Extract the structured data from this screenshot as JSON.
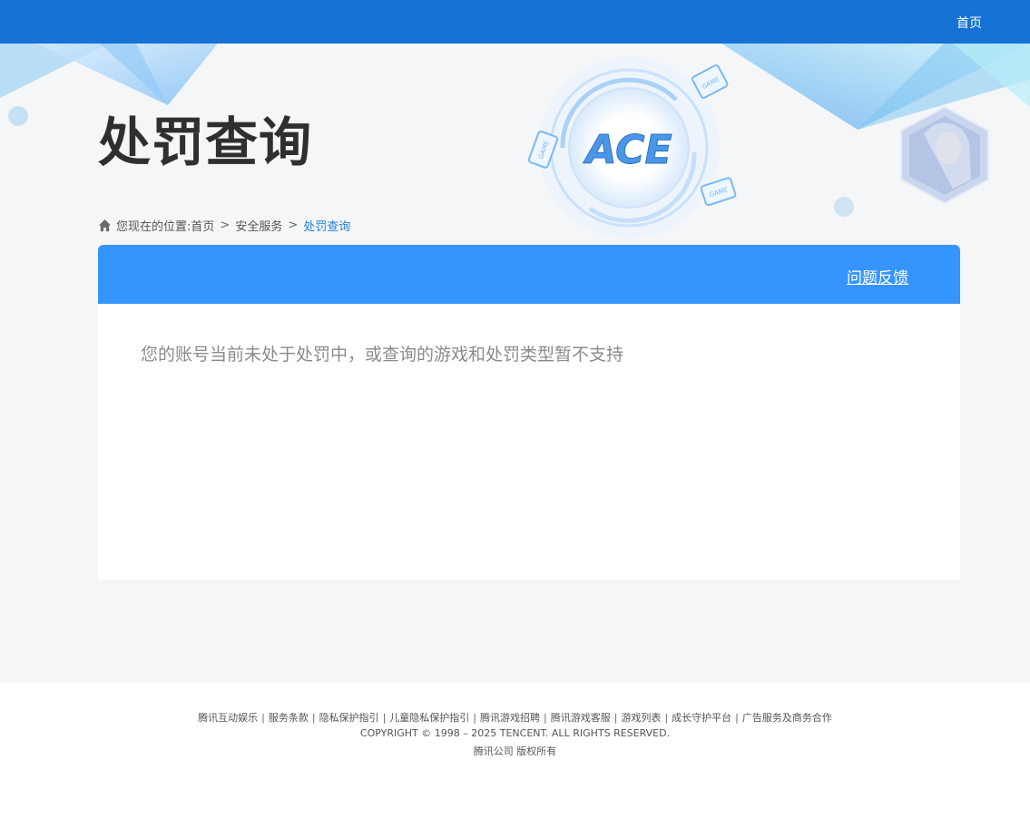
{
  "topbar": {
    "home_label": "首页"
  },
  "page": {
    "title": "处罚查询"
  },
  "breadcrumb": {
    "prefix": "您现在的位置:",
    "items": [
      "首页",
      "安全服务"
    ],
    "separator": ">",
    "current": "处罚查询"
  },
  "panel": {
    "feedback_label": "问题反馈",
    "message": "您的账号当前未处于处罚中，或查询的游戏和处罚类型暂不支持"
  },
  "banner": {
    "logo_text": "ACE",
    "game_tags": [
      "GAME",
      "GAME",
      "GAME"
    ]
  },
  "footer": {
    "links": [
      "腾讯互动娱乐",
      "服务条款",
      "隐私保护指引",
      "儿童隐私保护指引",
      "腾讯游戏招聘",
      "腾讯游戏客服",
      "游戏列表",
      "成长守护平台",
      "广告服务及商务合作"
    ],
    "link_separator": "|",
    "copyright": "COPYRIGHT © 1998 – 2025 TENCENT. ALL RIGHTS RESERVED.",
    "company": "腾讯公司 版权所有"
  },
  "colors": {
    "topbar": "#1672d5",
    "panel_header": "#3695fd",
    "breadcrumb_current": "#1e7ed8"
  }
}
